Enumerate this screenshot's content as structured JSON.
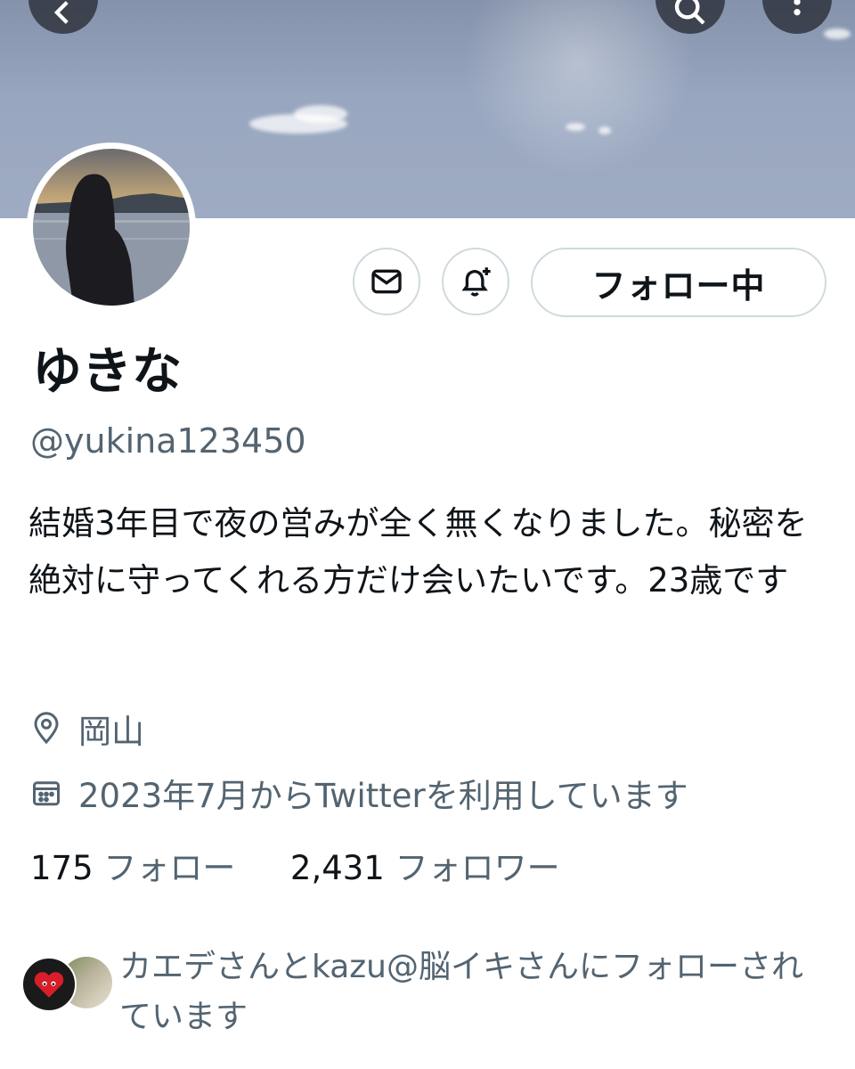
{
  "profile": {
    "display_name": "ゆきな",
    "handle": "@yukina123450",
    "bio": "結婚3年目で夜の営みが全く無くなりました。秘密を絶対に守ってくれる方だけ会いたいです。23歳です",
    "location": "岡山",
    "joined": "2023年7月からTwitterを利用しています"
  },
  "actions": {
    "follow_label": "フォロー中",
    "message_icon": "mail-icon",
    "notify_icon": "bell-plus-icon"
  },
  "header": {
    "back_icon": "chevron-left-icon",
    "search_icon": "search-icon",
    "more_icon": "more-vertical-icon"
  },
  "stats": {
    "following_count": "175",
    "following_label": "フォロー",
    "followers_count": "2,431",
    "followers_label": "フォロワー"
  },
  "followed_by": {
    "text": "カエデさんとkazu@脳イキさんにフォローされています"
  },
  "colors": {
    "text_primary": "#0f1419",
    "text_secondary": "#536471",
    "border": "#cfd9de"
  }
}
